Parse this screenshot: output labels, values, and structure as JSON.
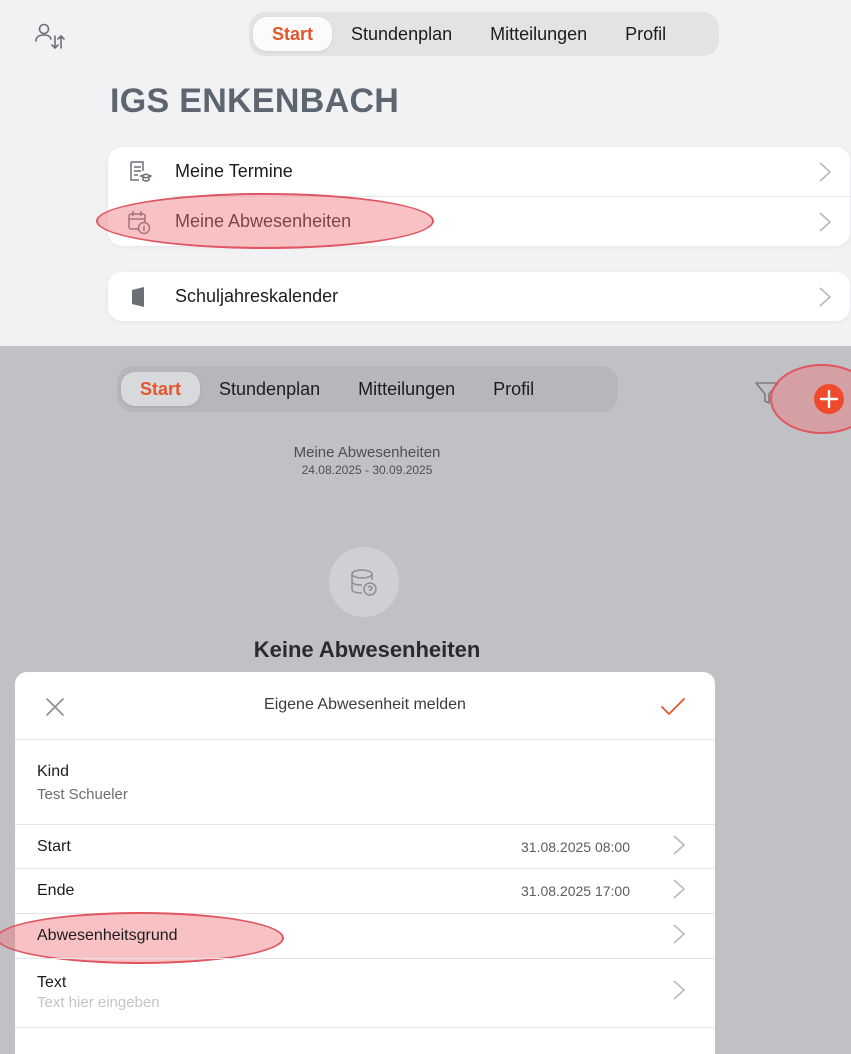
{
  "top": {
    "tabs": [
      {
        "label": "Start",
        "active": true
      },
      {
        "label": "Stundenplan",
        "active": false
      },
      {
        "label": "Mitteilungen",
        "active": false
      },
      {
        "label": "Profil",
        "active": false
      }
    ],
    "school_name": "IGS ENKENBACH",
    "menu": [
      {
        "label": "Meine Termine",
        "icon": "calendar-list-icon"
      },
      {
        "label": "Meine Abwesenheiten",
        "icon": "calendar-info-icon"
      }
    ],
    "calendar_item": {
      "label": "Schuljahreskalender",
      "icon": "book-icon"
    }
  },
  "bottom": {
    "tabs": [
      {
        "label": "Start",
        "active": true
      },
      {
        "label": "Stundenplan",
        "active": false
      },
      {
        "label": "Mitteilungen",
        "active": false
      },
      {
        "label": "Profil",
        "active": false
      }
    ],
    "header_title": "Meine Abwesenheiten",
    "header_range": "24.08.2025 - 30.09.2025",
    "empty_title": "Keine Abwesenheiten",
    "sheet": {
      "title": "Eigene Abwesenheit melden",
      "kind_label": "Kind",
      "kind_value": "Test Schueler",
      "start_label": "Start",
      "start_value": "31.08.2025 08:00",
      "end_label": "Ende",
      "end_value": "31.08.2025 17:00",
      "reason_label": "Abwesenheitsgrund",
      "text_label": "Text",
      "text_placeholder": "Text hier eingeben"
    }
  },
  "colors": {
    "accent": "#e2562d",
    "add_button": "#ef4a2e",
    "highlight": "#f0787d"
  }
}
